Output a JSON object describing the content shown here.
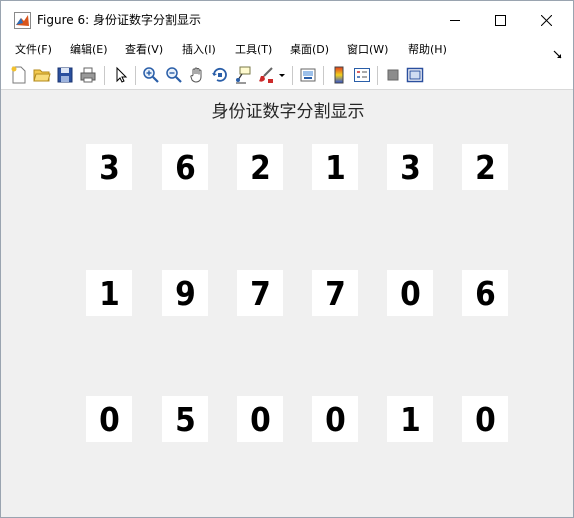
{
  "window": {
    "title": "Figure 6: 身份证数字分割显示",
    "app_icon": "matlab-icon"
  },
  "menu": {
    "items": [
      "文件(F)",
      "编辑(E)",
      "查看(V)",
      "插入(I)",
      "工具(T)",
      "桌面(D)",
      "窗口(W)",
      "帮助(H)"
    ]
  },
  "toolbar": {
    "buttons": [
      "new-figure-icon",
      "open-file-icon",
      "save-icon",
      "print-icon",
      "pointer-icon",
      "zoom-in-icon",
      "zoom-out-icon",
      "pan-icon",
      "rotate-3d-icon",
      "data-cursor-icon",
      "brush-icon",
      "brush-dropdown-icon",
      "link-plot-icon",
      "insert-colorbar-icon",
      "insert-legend-icon",
      "hide-plot-tools-icon",
      "show-plot-tools-icon"
    ]
  },
  "figure": {
    "title": "身份证数字分割显示",
    "digits": [
      "3",
      "6",
      "2",
      "1",
      "3",
      "2",
      "1",
      "9",
      "7",
      "7",
      "0",
      "6",
      "0",
      "5",
      "0",
      "0",
      "1",
      "0"
    ]
  }
}
